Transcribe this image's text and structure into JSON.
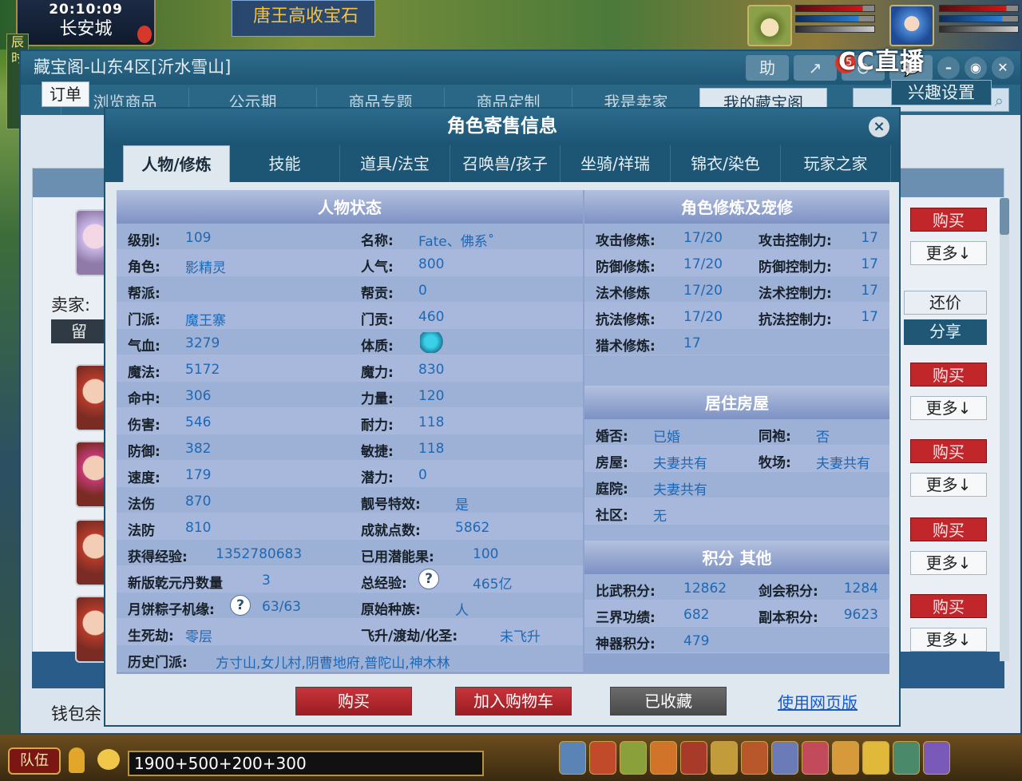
{
  "game": {
    "clock": "20:10:09",
    "city": "长安城",
    "quest": "唐王高收宝石",
    "side_strip": "辰时"
  },
  "stream": {
    "logo": "CC直播",
    "badge": "45"
  },
  "shop": {
    "title": "藏宝阁-山东4区[沂水雪山]",
    "header_icons": [
      "助",
      "↗",
      "⊖",
      "💬"
    ],
    "tabs": [
      "浏览商品",
      "公示期",
      "商品专题",
      "商品定制",
      "我是卖家",
      "我的藏宝阁"
    ],
    "order_btn": "订单",
    "interest_btn": "兴趣设置",
    "seller_label": "卖家:",
    "msg_btn": "留",
    "wallet_label": "钱包余",
    "buy_label": "购买",
    "more_label": "更多↓",
    "bargain_label": "还价",
    "share_label": "分享"
  },
  "modal": {
    "title": "角色寄售信息",
    "close": "×",
    "tabs": [
      "人物/修炼",
      "技能",
      "道具/法宝",
      "召唤兽/孩子",
      "坐骑/祥瑞",
      "锦衣/染色",
      "玩家之家"
    ],
    "status_title": "人物状态",
    "status_rows": [
      [
        {
          "l": "级别:",
          "v": "109"
        },
        {
          "l": "名称:",
          "v": "Fate、佛系˚"
        }
      ],
      [
        {
          "l": "角色:",
          "v": "影精灵"
        },
        {
          "l": "人气:",
          "v": "800"
        }
      ],
      [
        {
          "l": "帮派:",
          "v": ""
        },
        {
          "l": "帮贡:",
          "v": "0"
        }
      ],
      [
        {
          "l": "门派:",
          "v": "魔王寨"
        },
        {
          "l": "门贡:",
          "v": "460"
        }
      ],
      [
        {
          "l": "气血:",
          "v": "3279"
        },
        {
          "l": "体质:",
          "v": ""
        }
      ],
      [
        {
          "l": "魔法:",
          "v": "5172"
        },
        {
          "l": "魔力:",
          "v": "830"
        }
      ],
      [
        {
          "l": "命中:",
          "v": "306"
        },
        {
          "l": "力量:",
          "v": "120"
        }
      ],
      [
        {
          "l": "伤害:",
          "v": "546"
        },
        {
          "l": "耐力:",
          "v": "118"
        }
      ],
      [
        {
          "l": "防御:",
          "v": "382"
        },
        {
          "l": "敏捷:",
          "v": "118"
        }
      ],
      [
        {
          "l": "速度:",
          "v": "179"
        },
        {
          "l": "潜力:",
          "v": "0"
        }
      ],
      [
        {
          "l": "法伤",
          "v": "870"
        },
        {
          "l": "靓号特效:",
          "v": "是"
        }
      ],
      [
        {
          "l": "法防",
          "v": "810"
        },
        {
          "l": "成就点数:",
          "v": "5862"
        }
      ],
      [
        {
          "l": "获得经验:",
          "v": "1352780683"
        },
        {
          "l": "已用潜能果:",
          "v": "100"
        }
      ],
      [
        {
          "l": "新版乾元丹数量",
          "v": "3"
        },
        {
          "l": "总经验:",
          "v": "465亿"
        }
      ],
      [
        {
          "l": "月饼粽子机缘:",
          "v": "63/63"
        },
        {
          "l": "原始种族:",
          "v": "人"
        }
      ],
      [
        {
          "l": "生死劫:",
          "v": "零层"
        },
        {
          "l": "飞升/渡劫/化圣:",
          "v": "未飞升"
        }
      ]
    ],
    "history_label": "历史门派:",
    "history_value": "方寸山,女儿村,阴曹地府,普陀山,神木林",
    "question_mark": "?",
    "cultivation_title": "角色修炼及宠修",
    "cultivation_rows": [
      [
        {
          "l": "攻击修炼:",
          "v": "17/20"
        },
        {
          "l": "攻击控制力:",
          "v": "17"
        }
      ],
      [
        {
          "l": "防御修炼:",
          "v": "17/20"
        },
        {
          "l": "防御控制力:",
          "v": "17"
        }
      ],
      [
        {
          "l": "法术修炼",
          "v": "17/20"
        },
        {
          "l": "法术控制力:",
          "v": "17"
        }
      ],
      [
        {
          "l": "抗法修炼:",
          "v": "17/20"
        },
        {
          "l": "抗法控制力:",
          "v": "17"
        }
      ],
      [
        {
          "l": "猎术修炼:",
          "v": "17"
        },
        {
          "l": "",
          "v": ""
        }
      ]
    ],
    "house_title": "居住房屋",
    "house_rows": [
      [
        {
          "l": "婚否:",
          "v": "已婚"
        },
        {
          "l": "同袍:",
          "v": "否"
        }
      ],
      [
        {
          "l": "房屋:",
          "v": "夫妻共有"
        },
        {
          "l": "牧场:",
          "v": "夫妻共有"
        }
      ],
      [
        {
          "l": "庭院:",
          "v": "夫妻共有"
        },
        {
          "l": "",
          "v": ""
        }
      ],
      [
        {
          "l": "社区:",
          "v": "无"
        },
        {
          "l": "",
          "v": ""
        }
      ]
    ],
    "score_title": "积分 其他",
    "score_rows": [
      [
        {
          "l": "比武积分:",
          "v": "12862"
        },
        {
          "l": "剑会积分:",
          "v": "1284"
        }
      ],
      [
        {
          "l": "三界功绩:",
          "v": "682"
        },
        {
          "l": "副本积分:",
          "v": "9623"
        }
      ],
      [
        {
          "l": "神器积分:",
          "v": "479"
        },
        {
          "l": "",
          "v": ""
        }
      ]
    ],
    "buttons": {
      "buy": "购买",
      "add_cart": "加入购物车",
      "collected": "已收藏",
      "web": "使用网页版"
    }
  },
  "gamebar": {
    "team": "队伍",
    "chat_text": "1900+500+200+300"
  },
  "colors": {
    "accent_blue": "#1d5675",
    "value_blue": "#1f68b3",
    "buy_red": "#c0262a"
  }
}
